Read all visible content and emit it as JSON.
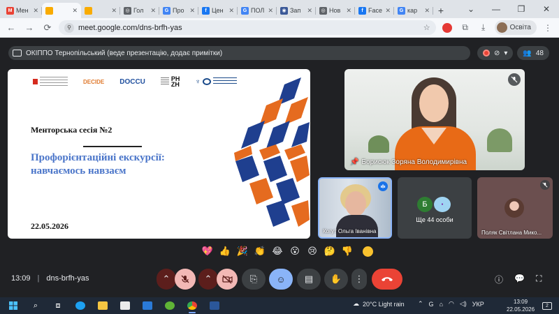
{
  "browser": {
    "tabs": [
      {
        "label": "Мен",
        "fav_color": "#ea4335",
        "fav_glyph": "M"
      },
      {
        "label": "",
        "fav_color": "#f9ab00",
        "fav_glyph": "",
        "active": true
      },
      {
        "label": "",
        "fav_color": "#f9ab00",
        "fav_glyph": ""
      },
      {
        "label": "Гол",
        "fav_color": "#5f6368",
        "fav_glyph": "◎"
      },
      {
        "label": "Про",
        "fav_color": "#4285f4",
        "fav_glyph": "G"
      },
      {
        "label": "Цен",
        "fav_color": "#1877f2",
        "fav_glyph": "f"
      },
      {
        "label": "ПОЛ",
        "fav_color": "#4285f4",
        "fav_glyph": "G"
      },
      {
        "label": "Зап",
        "fav_color": "#3b5998",
        "fav_glyph": "◉"
      },
      {
        "label": "Нов",
        "fav_color": "#5f6368",
        "fav_glyph": "◎"
      },
      {
        "label": "Face",
        "fav_color": "#1877f2",
        "fav_glyph": "f"
      },
      {
        "label": "кар",
        "fav_color": "#4285f4",
        "fav_glyph": "G"
      }
    ],
    "new_tab": "+",
    "window_controls": [
      "⌄",
      "—",
      "❐",
      "✕"
    ],
    "url": "meet.google.com/dns-brfh-yas",
    "profile_label": "Освіта"
  },
  "meet": {
    "presenter_text": "ОКІППО Тернопільський (веде презентацію, додає примітки)",
    "participant_count": "48",
    "slide": {
      "session": "Менторська сесія  №2",
      "title": "Профорієнтаційні екскурсії: навчаємось навзаєм",
      "date": "22.05.2026",
      "logos": {
        "decide": "DECIDE",
        "docu": "DOCCU",
        "phzh_1": "PH",
        "phzh_2": "ZH"
      }
    },
    "tiles": {
      "main_name": "Борисюк Зоряна Володимирівна",
      "kogut_name": "Когут Ольга Іванівна",
      "more_initial": "Б",
      "more_label": "Ще 44 особи",
      "polyak_name": "Поляк Світлана Мико..."
    },
    "reactions": [
      "💖",
      "👍",
      "🎉",
      "👏",
      "😂",
      "😮",
      "😢",
      "🤔",
      "👎"
    ],
    "time": "13:09",
    "code": "dns-brfh-yas"
  },
  "taskbar": {
    "weather": "20°C  Light rain",
    "lang": "УКР",
    "clock_time": "13:09",
    "clock_date": "22.05.2026",
    "notif_count": "2"
  },
  "colors": {
    "accent_blue": "#8ab4f8",
    "hangup_red": "#ea4335",
    "slide_title_blue": "#4a75c9",
    "muted_red_bg": "#5c1e1c"
  }
}
